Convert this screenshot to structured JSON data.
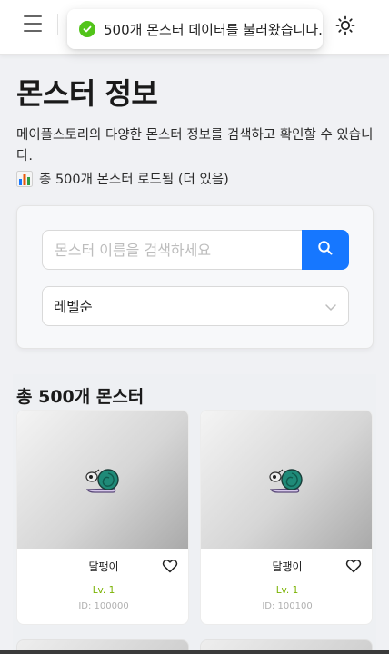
{
  "header": {
    "menu_icon": "hamburger-menu-icon",
    "theme_icon": "sun-icon"
  },
  "toast": {
    "message": "500개 몬스터 데이터를 불러왔습니다.",
    "icon": "check-circle-icon",
    "color": "#52c41a"
  },
  "page": {
    "title": "몬스터 정보",
    "description": "메이플스토리의 다양한 몬스터 정보를 검색하고 확인할 수 있습니다.",
    "load_status": "총 500개 몬스터 로드됨 (더 있음)",
    "load_status_icon": "bar-chart-icon"
  },
  "search": {
    "placeholder": "몬스터 이름을 검색하세요",
    "value": "",
    "button_icon": "search-icon",
    "accent": "#1677ff"
  },
  "sort": {
    "selected": "레벨순"
  },
  "results": {
    "title": "총 500개 몬스터",
    "monsters": [
      {
        "name": "달팽이",
        "level": "Lv. 1",
        "id": "ID: 100000"
      },
      {
        "name": "달팽이",
        "level": "Lv. 1",
        "id": "ID: 100100"
      }
    ]
  }
}
